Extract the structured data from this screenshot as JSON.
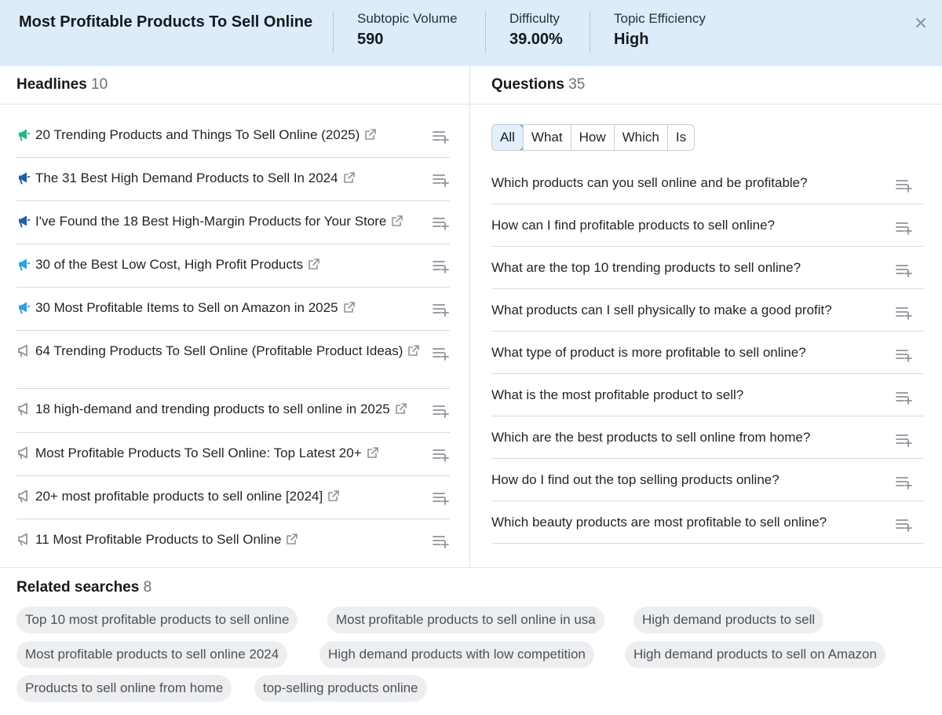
{
  "header": {
    "title": "Most Profitable Products To Sell Online",
    "metrics": [
      {
        "label": "Subtopic Volume",
        "value": "590"
      },
      {
        "label": "Difficulty",
        "value": "39.00%"
      },
      {
        "label": "Topic Efficiency",
        "value": "High"
      }
    ],
    "close_icon": "close-icon"
  },
  "headlines": {
    "title": "Headlines",
    "count": "10",
    "items": [
      {
        "text": "20 Trending Products and Things To Sell Online (2025)",
        "icon": "megaphone-icon",
        "icon_color": "#20b68c"
      },
      {
        "text": "The 31 Best High Demand Products to Sell In 2024",
        "icon": "megaphone-icon",
        "icon_color": "#1d5fa8"
      },
      {
        "text": "I've Found the 18 Best High-Margin Products for Your Store",
        "icon": "megaphone-icon",
        "icon_color": "#1d5fa8"
      },
      {
        "text": "30 of the Best Low Cost, High Profit Products",
        "icon": "megaphone-icon",
        "icon_color": "#2ea3d9"
      },
      {
        "text": "30 Most Profitable Items to Sell on Amazon in 2025",
        "icon": "megaphone-icon",
        "icon_color": "#2ea3d9"
      },
      {
        "text": "64 Trending Products To Sell Online (Profitable Product Ideas)",
        "icon": "megaphone-outline-icon",
        "icon_color": "#8a9098"
      },
      {
        "text": "18 high-demand and trending products to sell online in 2025",
        "icon": "megaphone-outline-icon",
        "icon_color": "#8a9098"
      },
      {
        "text": "Most Profitable Products To Sell Online: Top Latest 20+",
        "icon": "megaphone-outline-icon",
        "icon_color": "#8a9098"
      },
      {
        "text": "20+ most profitable products to sell online [2024]",
        "icon": "megaphone-outline-icon",
        "icon_color": "#8a9098"
      },
      {
        "text": "11 Most Profitable Products to Sell Online",
        "icon": "megaphone-outline-icon",
        "icon_color": "#8a9098"
      }
    ]
  },
  "questions": {
    "title": "Questions",
    "count": "35",
    "filters": [
      "All",
      "What",
      "How",
      "Which",
      "Is"
    ],
    "active_filter": "All",
    "items": [
      "Which products can you sell online and be profitable?",
      "How can I find profitable products to sell online?",
      "What are the top 10 trending products to sell online?",
      "What products can I sell physically to make a good profit?",
      "What type of product is more profitable to sell online?",
      "What is the most profitable product to sell?",
      "Which are the best products to sell online from home?",
      "How do I find out the top selling products online?",
      "Which beauty products are most profitable to sell online?"
    ]
  },
  "related": {
    "title": "Related searches",
    "count": "8",
    "chips": [
      "Top 10 most profitable products to sell online",
      "Most profitable products to sell online in usa",
      "High demand products to sell",
      "Most profitable products to sell online 2024",
      "High demand products with low competition",
      "High demand products to sell on Amazon",
      "Products to sell online from home",
      "top-selling products online"
    ]
  },
  "colors": {
    "header_bg": "#dcecfb",
    "active_filter_border": "#2f6fb7",
    "chip_bg": "#eceef0"
  }
}
